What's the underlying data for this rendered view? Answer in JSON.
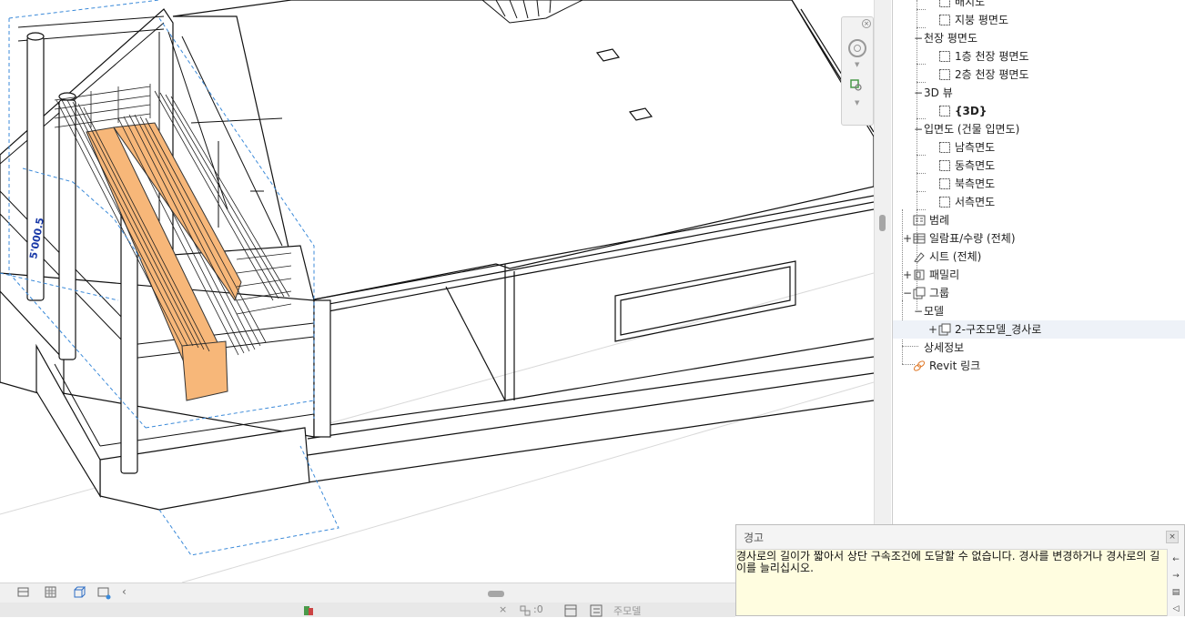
{
  "browser": {
    "items": [
      {
        "label": "배치도",
        "level": 3,
        "toggle": "",
        "icon": "view-icon"
      },
      {
        "label": "지붕 평면도",
        "level": 3,
        "toggle": "",
        "icon": "view-icon"
      },
      {
        "label": "천장 평면도",
        "level": 2,
        "toggle": "−",
        "icon": ""
      },
      {
        "label": "1층 천장 평면도",
        "level": 3,
        "toggle": "",
        "icon": "view-icon"
      },
      {
        "label": "2층 천장 평면도",
        "level": 3,
        "toggle": "",
        "icon": "view-icon"
      },
      {
        "label": "3D 뷰",
        "level": 2,
        "toggle": "−",
        "icon": ""
      },
      {
        "label": "{3D}",
        "level": 3,
        "toggle": "",
        "icon": "view-icon",
        "bold": true
      },
      {
        "label": "입면도 (건물 입면도)",
        "level": 2,
        "toggle": "−",
        "icon": ""
      },
      {
        "label": "남측면도",
        "level": 3,
        "toggle": "",
        "icon": "view-icon"
      },
      {
        "label": "동측면도",
        "level": 3,
        "toggle": "",
        "icon": "view-icon"
      },
      {
        "label": "북측면도",
        "level": 3,
        "toggle": "",
        "icon": "view-icon"
      },
      {
        "label": "서측면도",
        "level": 3,
        "toggle": "",
        "icon": "view-icon"
      },
      {
        "label": "범례",
        "level": 1,
        "toggle": "",
        "icon": "legend-icon"
      },
      {
        "label": "일람표/수량 (전체)",
        "level": 1,
        "toggle": "+",
        "icon": "schedule-icon"
      },
      {
        "label": "시트 (전체)",
        "level": 1,
        "toggle": "",
        "icon": "sheet-icon"
      },
      {
        "label": "패밀리",
        "level": 1,
        "toggle": "+",
        "icon": "family-icon"
      },
      {
        "label": "그룹",
        "level": 1,
        "toggle": "−",
        "icon": "group-icon"
      },
      {
        "label": "모델",
        "level": 2,
        "toggle": "−",
        "icon": ""
      },
      {
        "label": "2-구조모델_경사로",
        "level": 3,
        "toggle": "+",
        "icon": "group-icon",
        "selected": true
      },
      {
        "label": "상세정보",
        "level": 2,
        "toggle": "",
        "icon": ""
      },
      {
        "label": "Revit 링크",
        "level": 1,
        "toggle": "",
        "icon": "link-icon"
      }
    ]
  },
  "viewport": {
    "dimension_label": "5'000.5"
  },
  "statusbar": {
    "model_label": "주모델",
    "zero_count": ":0"
  },
  "warning": {
    "title": "경고",
    "close": "×",
    "message": "경사로의 길이가 짧아서 상단 구속조건에 도달할 수 없습니다. 경사를 변경하거나 경사로의 길이를 늘리십시오."
  },
  "colors": {
    "ramp": "#f7b779",
    "dashed": "#3b8ad9",
    "warning_bg": "#fffde0"
  }
}
